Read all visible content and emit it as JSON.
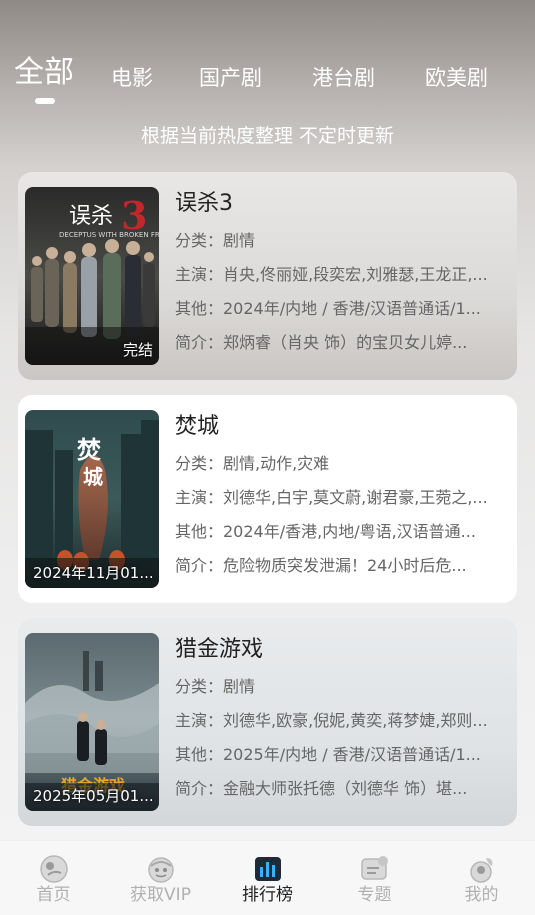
{
  "tabs": [
    {
      "label": "全部",
      "active": true
    },
    {
      "label": "电影",
      "active": false
    },
    {
      "label": "国产剧",
      "active": false
    },
    {
      "label": "港台剧",
      "active": false
    },
    {
      "label": "欧美剧",
      "active": false
    }
  ],
  "subtitle": "根据当前热度整理 不定时更新",
  "items": [
    {
      "title": "误杀3",
      "badge": "完结",
      "poster_text": "DECEPTUS WITH BROKEN FRAMS",
      "category": "分类：剧情",
      "cast": "主演：肖央,佟丽娅,段奕宏,刘雅瑟,王龙正,...",
      "other": "其他：2024年/内地 / 香港/汉语普通话/1...",
      "summary": "简介：郑炳睿（肖央 饰）的宝贝女儿婷..."
    },
    {
      "title": "焚城",
      "badge": "2024年11月01...",
      "category": "分类：剧情,动作,灾难",
      "cast": "主演：刘德华,白宇,莫文蔚,谢君豪,王菀之,...",
      "other": "其他：2024年/香港,内地/粤语,汉语普通...",
      "summary": "简介：危险物质突发泄漏！24小时后危..."
    },
    {
      "title": "猎金游戏",
      "badge": "2025年05月01...",
      "category": "分类：剧情",
      "cast": "主演：刘德华,欧豪,倪妮,黄奕,蒋梦婕,郑则...",
      "other": "其他：2025年/内地 / 香港/汉语普通话/1...",
      "summary": "简介：金融大师张托德（刘德华 饰）堪..."
    }
  ],
  "nav": [
    {
      "label": "首页",
      "icon": "home-icon",
      "active": false
    },
    {
      "label": "获取VIP",
      "icon": "vip-icon",
      "active": false
    },
    {
      "label": "排行榜",
      "icon": "ranking-icon",
      "active": true
    },
    {
      "label": "专题",
      "icon": "topic-icon",
      "active": false
    },
    {
      "label": "我的",
      "icon": "profile-icon",
      "active": false
    }
  ],
  "colors": {
    "accent_active": "#222222",
    "nav_inactive": "#b0b0b0",
    "tab_text": "#ffffff"
  }
}
